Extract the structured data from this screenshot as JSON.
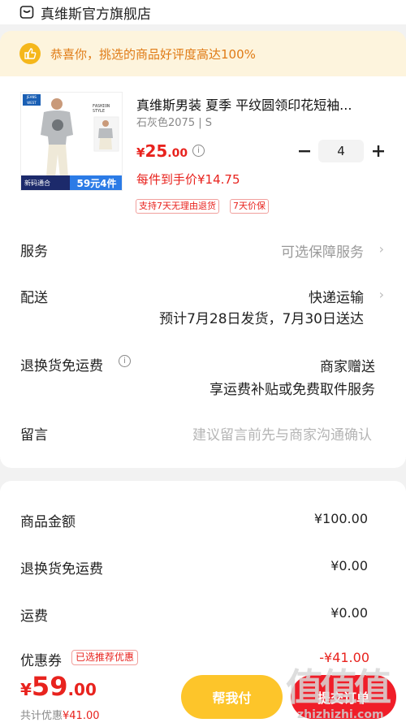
{
  "store": {
    "name": "真维斯官方旗舰店",
    "icon": "store-icon"
  },
  "banner": {
    "text": "恭喜你，挑选的商品好评度高达100%",
    "icon": "thumbs-up-icon"
  },
  "product": {
    "title": "真维斯男装 夏季 平纹圆领印花短袖...",
    "spec": "石灰色2075 | S",
    "price_symbol": "¥",
    "price_int": "25",
    "price_dec": ".00",
    "per_price": "每件到手价¥14.75",
    "tags": [
      "支持7天无理由退货",
      "7天价保"
    ],
    "quantity": "4",
    "image": {
      "fashion_label": "FASHION STYLE",
      "brand": "JEANSWEST",
      "banner_left": "新码通合",
      "banner_right": "59元4件"
    }
  },
  "rows": {
    "service": {
      "label": "服务",
      "value": "可选保障服务"
    },
    "delivery": {
      "label": "配送",
      "value": "快递运输",
      "sub": "预计7月28日发货，7月30日送达"
    },
    "return": {
      "label": "退换货免运费",
      "value": "商家赠送",
      "sub": "享运费补贴或免费取件服务"
    },
    "message": {
      "label": "留言",
      "placeholder": "建议留言前先与商家沟通确认"
    }
  },
  "summary": {
    "goods": {
      "label": "商品金额",
      "value": "¥100.00"
    },
    "return_fee": {
      "label": "退换货免运费",
      "value": "¥0.00"
    },
    "shipping": {
      "label": "运费",
      "value": "¥0.00"
    },
    "coupon": {
      "label": "优惠券",
      "badge": "已选推荐优惠",
      "value": "-¥41.00"
    }
  },
  "footer": {
    "total_symbol": "¥",
    "total_int": "59",
    "total_dec": ".00",
    "discount_label": "共计优惠",
    "discount_value": "¥41.00",
    "help_pay": "帮我付",
    "submit": "提交订单"
  },
  "watermark": {
    "main": "值值值",
    "url": "zhizhizhi.com"
  },
  "colors": {
    "accent": "#e8231e",
    "banner_bg": "#fdf4dd",
    "help_pay": "#fdc52a",
    "submit": "#f01d28"
  }
}
